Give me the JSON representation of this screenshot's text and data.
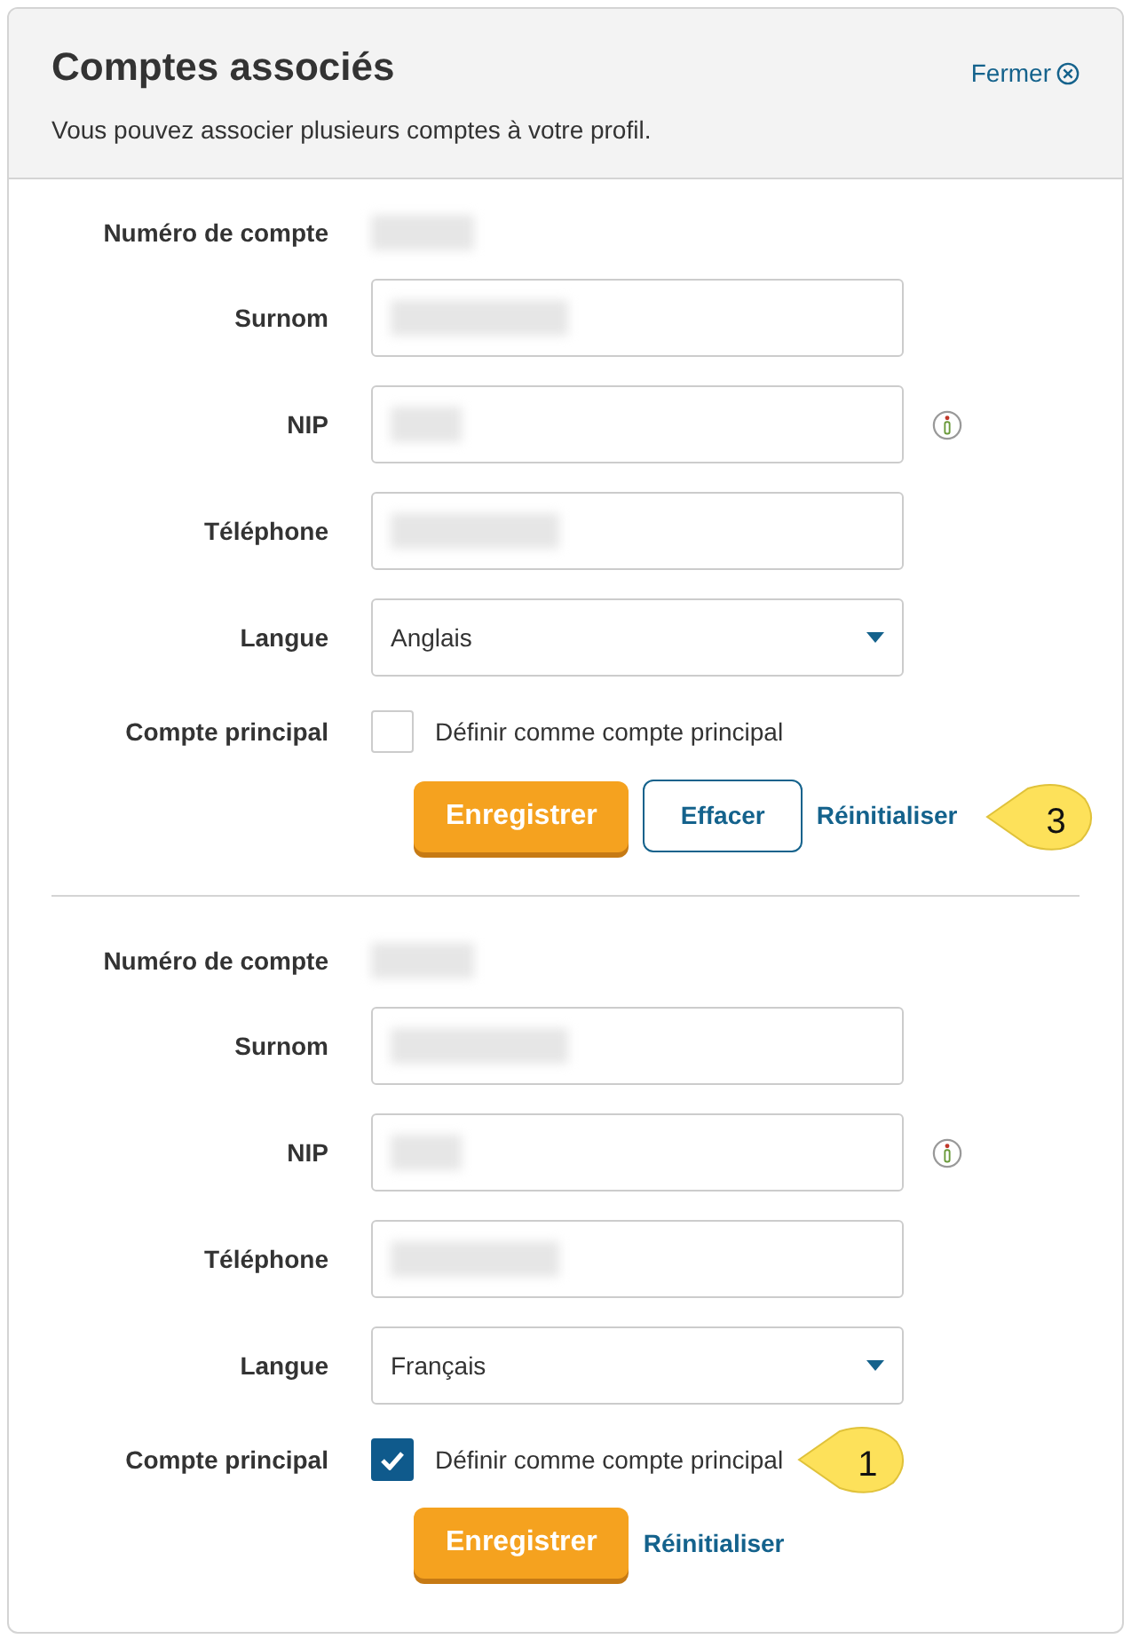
{
  "header": {
    "title": "Comptes associés",
    "subtitle": "Vous pouvez associer plusieurs comptes à votre profil.",
    "close_link": "Fermer"
  },
  "accounts": [
    {
      "fields": [
        {
          "kind": "static",
          "label": "Numéro de compte",
          "blurred": true
        },
        {
          "kind": "input",
          "label": "Surnom",
          "blurred": true
        },
        {
          "kind": "input",
          "label": "NIP",
          "blurred": true,
          "info": true
        },
        {
          "kind": "input",
          "label": "Téléphone",
          "blurred": true
        },
        {
          "kind": "select",
          "label": "Langue",
          "value": "Anglais"
        },
        {
          "kind": "checkbox",
          "label": "Compte principal",
          "text": "Définir comme compte principal",
          "checked": false
        }
      ],
      "buttons": [
        {
          "kind": "primary",
          "label": "Enregistrer"
        },
        {
          "kind": "outline",
          "label": "Effacer"
        },
        {
          "kind": "link",
          "label": "Réinitialiser",
          "callout": "3"
        }
      ]
    },
    {
      "fields": [
        {
          "kind": "static",
          "label": "Numéro de compte",
          "blurred": true
        },
        {
          "kind": "input",
          "label": "Surnom",
          "blurred": true
        },
        {
          "kind": "input",
          "label": "NIP",
          "blurred": true,
          "info": true
        },
        {
          "kind": "input",
          "label": "Téléphone",
          "blurred": true
        },
        {
          "kind": "select",
          "label": "Langue",
          "value": "Français"
        },
        {
          "kind": "checkbox",
          "label": "Compte principal",
          "text": "Définir comme compte principal",
          "checked": true,
          "callout": "1"
        }
      ],
      "buttons": [
        {
          "kind": "primary",
          "label": "Enregistrer"
        },
        {
          "kind": "link",
          "label": "Réinitialiser"
        }
      ]
    }
  ]
}
